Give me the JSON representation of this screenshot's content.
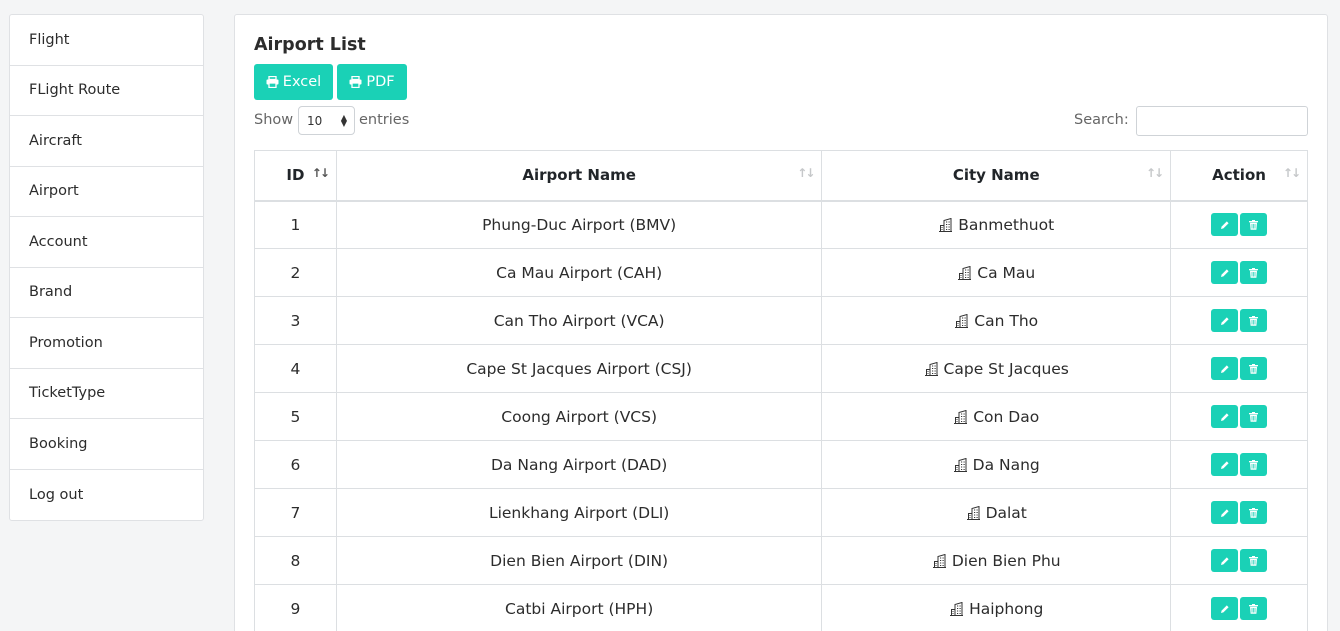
{
  "sidebar": {
    "items": [
      {
        "label": "Flight"
      },
      {
        "label": "FLight Route"
      },
      {
        "label": "Aircraft"
      },
      {
        "label": "Airport"
      },
      {
        "label": "Account"
      },
      {
        "label": "Brand"
      },
      {
        "label": "Promotion"
      },
      {
        "label": "TicketType"
      },
      {
        "label": "Booking"
      },
      {
        "label": "Log out"
      }
    ]
  },
  "panel": {
    "title": "Airport List",
    "excel_label": "Excel",
    "pdf_label": "PDF",
    "show_label": "Show",
    "entries_value": "10",
    "entries_label": "entries",
    "search_label": "Search:",
    "search_value": ""
  },
  "table": {
    "headers": {
      "id": "ID",
      "name": "Airport Name",
      "city": "City Name",
      "action": "Action"
    },
    "rows": [
      {
        "id": "1",
        "name": "Phung-Duc Airport (BMV)",
        "city": "Banmethuot"
      },
      {
        "id": "2",
        "name": "Ca Mau Airport (CAH)",
        "city": "Ca Mau"
      },
      {
        "id": "3",
        "name": "Can Tho Airport (VCA)",
        "city": "Can Tho"
      },
      {
        "id": "4",
        "name": "Cape St Jacques Airport (CSJ)",
        "city": "Cape St Jacques"
      },
      {
        "id": "5",
        "name": "Coong Airport (VCS)",
        "city": "Con Dao"
      },
      {
        "id": "6",
        "name": "Da Nang Airport (DAD)",
        "city": "Da Nang"
      },
      {
        "id": "7",
        "name": "Lienkhang Airport (DLI)",
        "city": "Dalat"
      },
      {
        "id": "8",
        "name": "Dien Bien Airport (DIN)",
        "city": "Dien Bien Phu"
      },
      {
        "id": "9",
        "name": "Catbi Airport (HPH)",
        "city": "Haiphong"
      }
    ]
  },
  "colors": {
    "accent": "#1ad1b6"
  }
}
